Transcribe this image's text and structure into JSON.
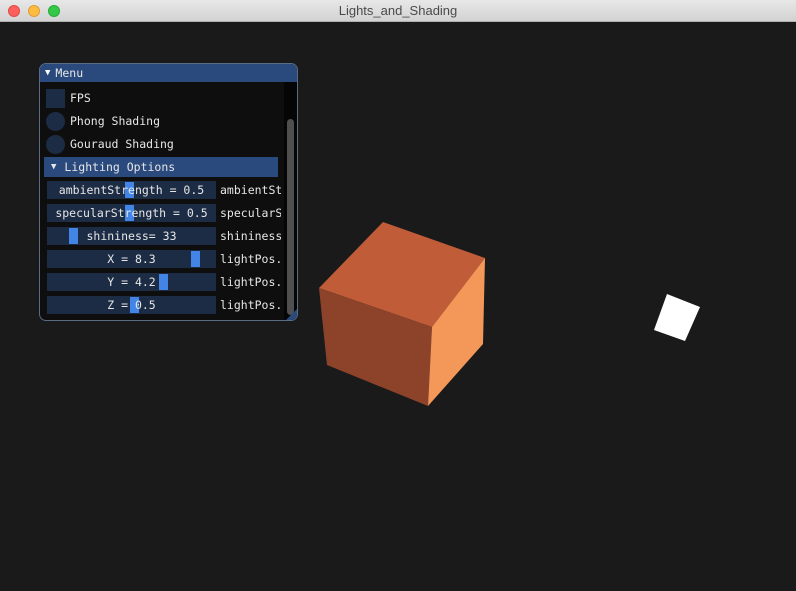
{
  "window": {
    "title": "Lights_and_Shading"
  },
  "menu": {
    "title": "Menu",
    "fps_label": "FPS",
    "phong_label": "Phong Shading",
    "gouraud_label": "Gouraud Shading",
    "lighting_header": "Lighting Options",
    "sliders": [
      {
        "text": "ambientStrength = 0.5",
        "label": "ambientSt",
        "value": 0.5
      },
      {
        "text": "specularStrength = 0.5",
        "label": "specularS",
        "value": 0.5
      },
      {
        "text": "shininess= 33",
        "label": "shininess",
        "value": 33
      },
      {
        "text": "X = 8.3",
        "label": "lightPos.",
        "value": 8.3
      },
      {
        "text": "Y = 4.2",
        "label": "lightPos.",
        "value": 4.2
      },
      {
        "text": "Z = 0.5",
        "label": "lightPos.",
        "value": 0.5
      }
    ]
  },
  "scene": {
    "cube_color": "#d2693b",
    "light_color": "#ffffff",
    "background": "#1a1a1a"
  }
}
